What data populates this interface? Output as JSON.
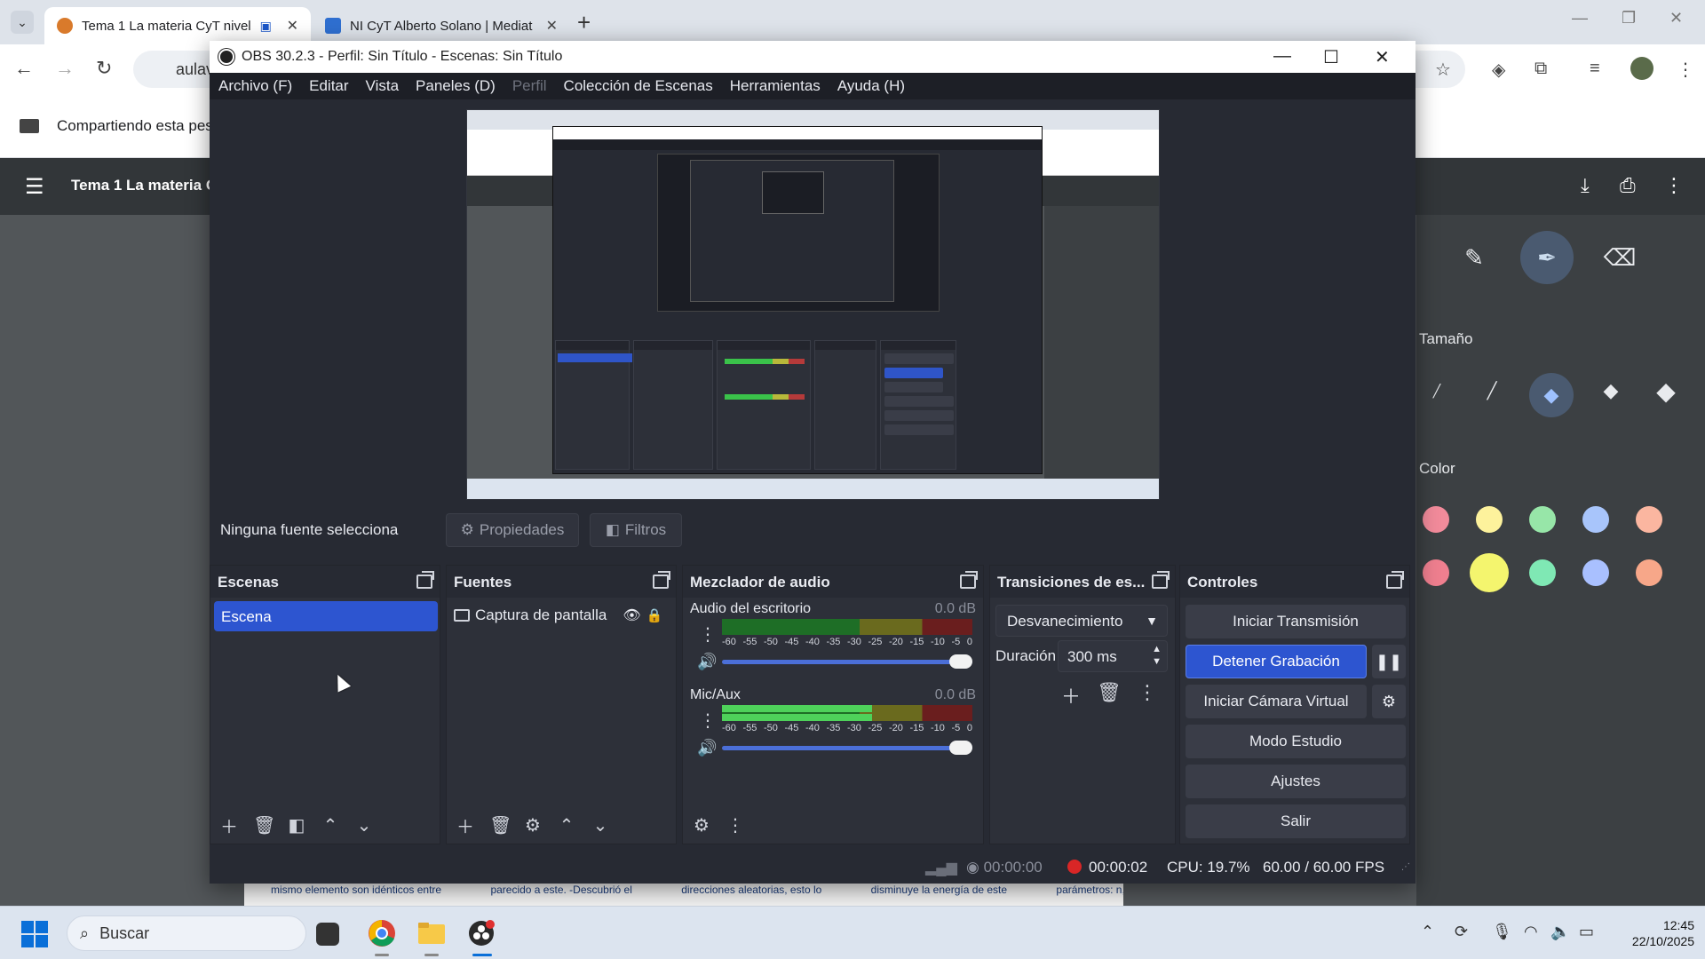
{
  "browser": {
    "tabs": [
      {
        "title": "Tema 1 La materia CyT nivel",
        "active": true
      },
      {
        "title": "NI CyT Alberto Solano | Mediat",
        "active": false
      }
    ],
    "address": "aulav",
    "share_banner": "Compartiendo esta pest",
    "pdf_title": "Tema 1 La materia C",
    "annotation_panel": {
      "size_label": "Tamaño",
      "color_label": "Color",
      "colors": [
        "#f28b9b",
        "#fdf29c",
        "#97e6a8",
        "#a8c5fb",
        "#fbb6a0",
        "#ef7f8f",
        "#f4f56e",
        "#7fe8b4",
        "#a9c0ff",
        "#f7a789"
      ]
    },
    "pdf_strip": [
      "mismo elemento son idénticos entre",
      "parecido a este. -Descubrió el",
      "direcciones aleatorias, esto lo",
      "disminuye la energía de este",
      "parámetros: n,l,m. -Postuló que los"
    ]
  },
  "obs": {
    "window_title": "OBS 30.2.3 - Perfil: Sin Título - Escenas: Sin Título",
    "menu": [
      "Archivo (F)",
      "Editar",
      "Vista",
      "Paneles (D)",
      "Perfil",
      "Colección de Escenas",
      "Herramientas",
      "Ayuda (H)"
    ],
    "source_bar": {
      "none_selected": "Ninguna fuente selecciona",
      "properties": "Propiedades",
      "filters": "Filtros"
    },
    "scenes": {
      "title": "Escenas",
      "items": [
        "Escena"
      ]
    },
    "sources": {
      "title": "Fuentes",
      "items": [
        "Captura de pantalla"
      ]
    },
    "mixer": {
      "title": "Mezclador de audio",
      "channels": [
        {
          "name": "Audio del escritorio",
          "db": "0.0 dB",
          "level": 0
        },
        {
          "name": "Mic/Aux",
          "db": "0.0 dB",
          "level": 0.6
        }
      ],
      "scale": [
        "-60",
        "-55",
        "-50",
        "-45",
        "-40",
        "-35",
        "-30",
        "-25",
        "-20",
        "-15",
        "-10",
        "-5",
        "0"
      ]
    },
    "transitions": {
      "title": "Transiciones de es...",
      "selected": "Desvanecimiento",
      "duration_label": "Duración",
      "duration_value": "300 ms"
    },
    "controls": {
      "title": "Controles",
      "start_stream": "Iniciar Transmisión",
      "stop_recording": "Detener Grabación",
      "virtual_camera": "Iniciar Cámara Virtual",
      "studio_mode": "Modo Estudio",
      "settings": "Ajustes",
      "exit": "Salir"
    },
    "status": {
      "stream_time": "00:00:00",
      "rec_time": "00:00:02",
      "cpu": "CPU: 19.7%",
      "fps": "60.00 / 60.00 FPS"
    }
  },
  "taskbar": {
    "search_placeholder": "Buscar",
    "time": "12:45",
    "date": "22/10/2025"
  }
}
